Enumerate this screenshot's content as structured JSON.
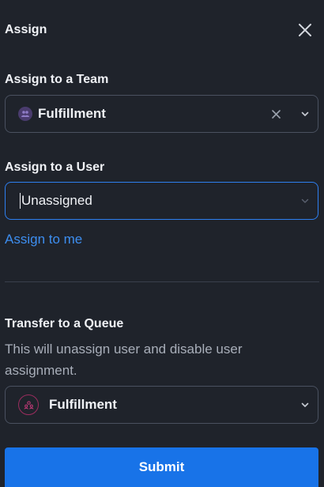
{
  "header": {
    "title": "Assign",
    "close_icon": "close-icon"
  },
  "team": {
    "label": "Assign to a Team",
    "value": "Fulfillment",
    "icon": "team-icon"
  },
  "user": {
    "label": "Assign to a User",
    "value": "Unassigned",
    "assign_to_me": "Assign to me"
  },
  "queue": {
    "label": "Transfer to a Queue",
    "description": "This will unassign user and disable user assignment.",
    "value": "Fulfillment",
    "icon": "queue-icon"
  },
  "submit_label": "Submit",
  "colors": {
    "background": "#1f232b",
    "accent": "#1873e8",
    "link": "#3d8ef0",
    "focus_border": "#2d7ff0",
    "queue_icon": "#9b2d5e"
  }
}
